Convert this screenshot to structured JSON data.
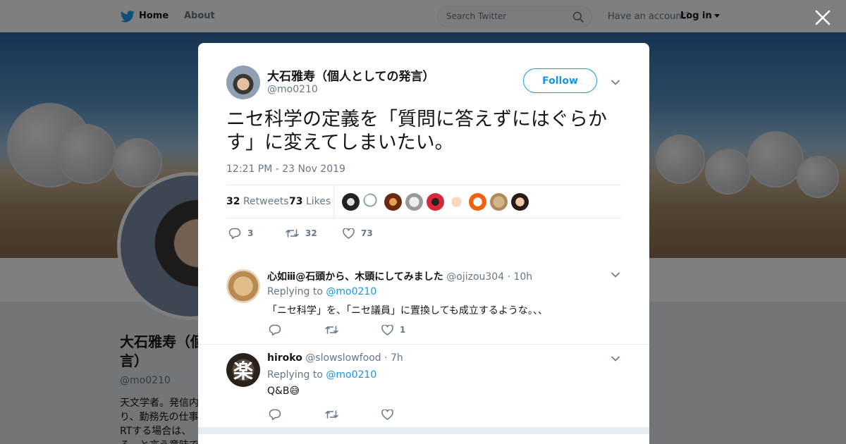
{
  "nav": {
    "home_label": "Home",
    "about_label": "About",
    "search_placeholder": "Search Twitter",
    "have_account": "Have an account?",
    "login_label": "Log in"
  },
  "profile": {
    "name": "大石雅寿（個人としての発言）",
    "name_visible": "大石雅寿（個\n言）",
    "handle": "@mo0210",
    "bio_visible": "天文学者。発信内\nり、勤務先の仕事\nRTする場合は、\nる、と言う意味で"
  },
  "tweet": {
    "author_name": "大石雅寿（個人としての発言）",
    "author_handle": "@mo0210",
    "follow_label": "Follow",
    "text": "ニセ科学の定義を「質問に答えずにはぐらかす」に変えてしまいたい。",
    "timestamp": "12:21 PM - 23 Nov 2019",
    "retweets_count": "32",
    "retweets_label": "Retweets",
    "likes_count": "73",
    "likes_label": "Likes",
    "reply_count": "3",
    "retweet_count": "32",
    "like_count": "73"
  },
  "replies": [
    {
      "name": "心如ⅲ@石頭から、木頭にしてみました",
      "handle": "@ojizou304",
      "time": "· 10h",
      "replying_prefix": "Replying to",
      "replying_to": "@mo0210",
      "text": "「ニセ科学」を、「ニセ議員」に置換しても成立するような。、、",
      "reply_count": "",
      "retweet_count": "",
      "like_count": "1"
    },
    {
      "name": "hiroko",
      "handle": "@slowslowfood",
      "time": "· 7h",
      "replying_prefix": "Replying to",
      "replying_to": "@mo0210",
      "text": "Q&B😅",
      "avatar_glyph": "楽",
      "reply_count": "",
      "retweet_count": "",
      "like_count": ""
    }
  ],
  "colors": {
    "accent": "#1b95e0",
    "secondary_text": "#657786",
    "border": "#e6ecf0",
    "overlay": "rgba(0,0,0,0.5)"
  },
  "icons": [
    "twitter-bird-icon",
    "home-icon",
    "search-icon",
    "caret-down-icon",
    "close-icon",
    "reply-icon",
    "retweet-icon",
    "heart-icon"
  ]
}
